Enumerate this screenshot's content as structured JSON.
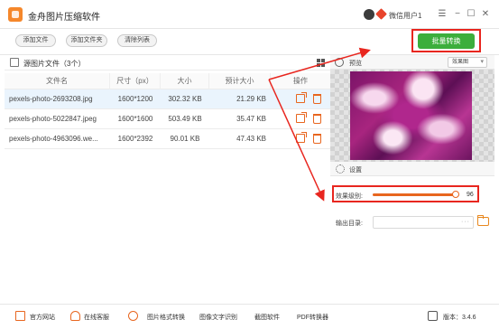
{
  "app": {
    "title": "金舟图片压缩软件",
    "user_name": "微信用户1"
  },
  "window_controls": {
    "menu": "☰",
    "minimize": "−",
    "maximize": "☐",
    "close": "✕"
  },
  "toolbar": {
    "add_file": "添加文件",
    "add_folder": "添加文件夹",
    "clear_list": "清除列表",
    "batch_convert": "批量转换"
  },
  "file_list": {
    "title": "源图片文件（3个）",
    "columns": [
      "文件名",
      "尺寸（px）",
      "大小",
      "预计大小",
      "操作"
    ],
    "rows": [
      {
        "name": "pexels-photo-2693208.jpg",
        "dims": "1600*1200",
        "size": "302.32 KB",
        "est": "21.29 KB",
        "selected": true
      },
      {
        "name": "pexels-photo-5022847.jpeg",
        "dims": "1600*1600",
        "size": "503.49 KB",
        "est": "35.47 KB",
        "selected": false
      },
      {
        "name": "pexels-photo-4963096.we...",
        "dims": "1600*2392",
        "size": "90.01 KB",
        "est": "47.43 KB",
        "selected": false
      }
    ]
  },
  "preview": {
    "label": "预览",
    "mode": "效果图"
  },
  "settings": {
    "label": "设置",
    "level_label": "效果级别:",
    "level_value": "96",
    "level_fraction": 0.96,
    "output_label": "输出目录:",
    "output_dots": "···"
  },
  "statusbar": {
    "website": "官方网站",
    "support": "在线客服",
    "format_convert": "图片格式转换",
    "ocr": "图像文字识别",
    "screenshot": "截图软件",
    "pdf": "PDF转换器",
    "version": "版本：3.4.6"
  },
  "colors": {
    "accent": "#e8661f",
    "primary_button": "#3cae3c",
    "highlight_box": "#e8261f",
    "selected_row": "#eaf4fd"
  }
}
